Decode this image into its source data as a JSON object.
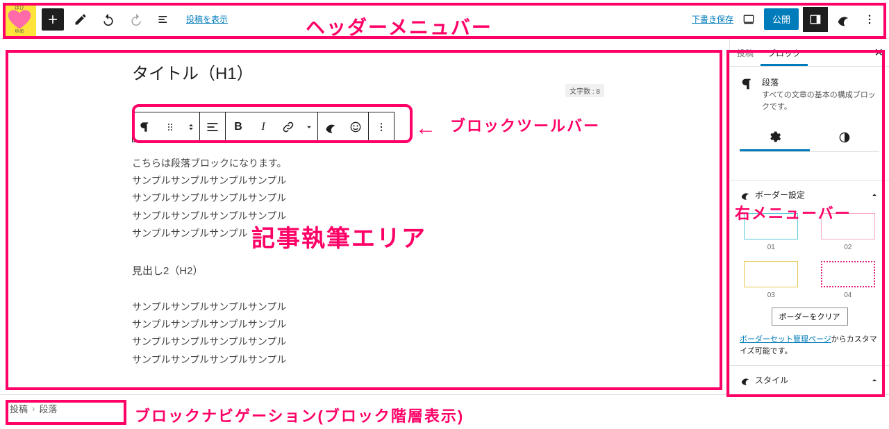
{
  "topbar": {
    "view_post_label": "投稿を表示",
    "draft_save_label": "下書き保存",
    "publish_label": "公開"
  },
  "editor": {
    "title": "タイトル（H1）",
    "char_count_label": "文字数 : 8",
    "paragraphs_a": [
      "こちらは段落ブロックになります。",
      "サンプルサンプルサンプルサンプル",
      "サンプルサンプルサンプルサンプル",
      "サンプルサンプルサンプルサンプル",
      "サンプルサンプルサンプル"
    ],
    "heading2": "見出し2（H2）",
    "paragraphs_b": [
      "サンプルサンプルサンプルサンプル",
      "サンプルサンプルサンプルサンプル",
      "サンプルサンプルサンプルサンプル",
      "サンプルサンプルサンプルサンプル"
    ]
  },
  "sidebar": {
    "tab_post": "投稿",
    "tab_block": "ブロック",
    "block_name": "段落",
    "block_desc": "すべての文章の基本の構成ブロックです。",
    "panel_border": "ボーダー設定",
    "border_items": {
      "i1": "01",
      "i2": "02",
      "i3": "03",
      "i4": "04"
    },
    "clear_border": "ボーダーをクリア",
    "border_link": "ボーダーセット管理ページ",
    "border_link_suffix": "からカスタマイズ可能です。",
    "panel_style": "スタイル"
  },
  "breadcrumb": {
    "item1": "投稿",
    "item2": "段落"
  },
  "annotations": {
    "header_label": "ヘッダーメニュバー",
    "toolbar_label": "ブロックツールバー",
    "editor_label": "記事執筆エリア",
    "sidebar_label": "右メニューバー",
    "breadcrumb_label": "ブロックナビゲーション(ブロック階層表示)"
  }
}
